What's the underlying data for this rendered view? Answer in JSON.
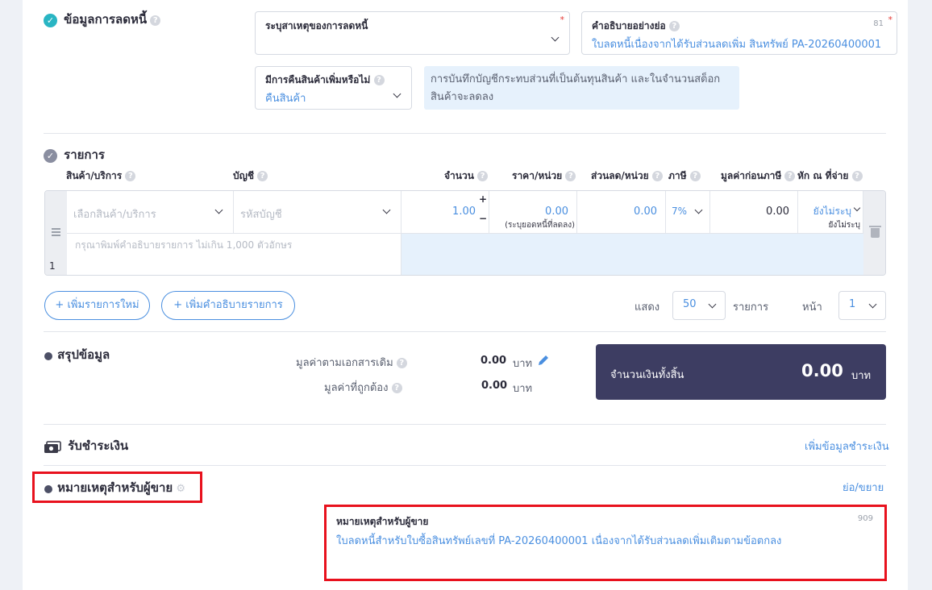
{
  "reduction": {
    "title": "ข้อมูลการลดหนี้",
    "reason_label": "ระบุสาเหตุของการลดหนี้",
    "reason_required": "*",
    "desc_label": "คำอธิบายอย่างย่อ",
    "desc_count": "81",
    "desc_required": "*",
    "desc_value": "ใบลดหนี้เนื่องจากได้รับส่วนลดเพิ่ม สินทรัพย์ PA-20260400001",
    "return_label": "มีการคืนสินค้าเพิ่มหรือไม่",
    "return_value": "คืนสินค้า",
    "info_note": "การบันทึกบัญชีกระทบส่วนที่เป็นต้นทุนสินค้า และในจำนวนสต็อกสินค้าจะลดลง"
  },
  "items": {
    "title": "รายการ",
    "columns": {
      "product": "สินค้า/บริการ",
      "account": "บัญชี",
      "qty": "จำนวน",
      "price": "ราคา/หน่วย",
      "discount": "ส่วนลด/หน่วย",
      "tax": "ภาษี",
      "pretax": "มูลค่าก่อนภาษี",
      "withholding": "หัก ณ ที่จ่าย"
    },
    "row": {
      "index": "1",
      "product_placeholder": "เลือกสินค้า/บริการ",
      "account_placeholder": "รหัสบัญชี",
      "qty": "1.00",
      "qty_plus": "+",
      "qty_minus": "−",
      "price": "0.00",
      "price_note": "(ระบุยอดหนี้ที่ลดลง)",
      "discount": "0.00",
      "tax": "7%",
      "pretax": "0.00",
      "withholding": "ยังไม่ระบุ",
      "withholding_sub": "ยังไม่ระบุ",
      "desc_placeholder": "กรุณาพิมพ์คำอธิบายรายการ ไม่เกิน 1,000 ตัวอักษร"
    },
    "add_item": "+ เพิ่มรายการใหม่",
    "add_desc": "+ เพิ่มคำอธิบายรายการ",
    "show_label": "แสดง",
    "page_size": "50",
    "items_label": "รายการ",
    "page_label": "หน้า",
    "page_value": "1"
  },
  "summary": {
    "title": "สรุปข้อมูล",
    "original_label": "มูลค่าตามเอกสารเดิม",
    "original_value": "0.00",
    "original_unit": "บาท",
    "correct_label": "มูลค่าที่ถูกต้อง",
    "correct_value": "0.00",
    "correct_unit": "บาท",
    "total_label": "จำนวนเงินทั้งสิ้น",
    "total_value": "0.00",
    "total_unit": "บาท"
  },
  "payment": {
    "title": "รับชำระเงิน",
    "add_link": "เพิ่มข้อมูลชำระเงิน"
  },
  "notes": {
    "title": "หมายเหตุสำหรับผู้ขาย",
    "toggle": "ย่อ/ขยาย",
    "field_label": "หมายเหตุสำหรับผู้ขาย",
    "count": "909",
    "value": "ใบลดหนี้สำหรับใบซื้อสินทรัพย์เลขที่ PA-20260400001 เนื่องจากได้รับส่วนลดเพิ่มเติมตามข้อตกลง"
  },
  "colors": {
    "accent": "#4a8fe0",
    "teal_check": "#29b5c3",
    "total_bg": "#3d3d62",
    "highlight_red": "#e8111d"
  }
}
